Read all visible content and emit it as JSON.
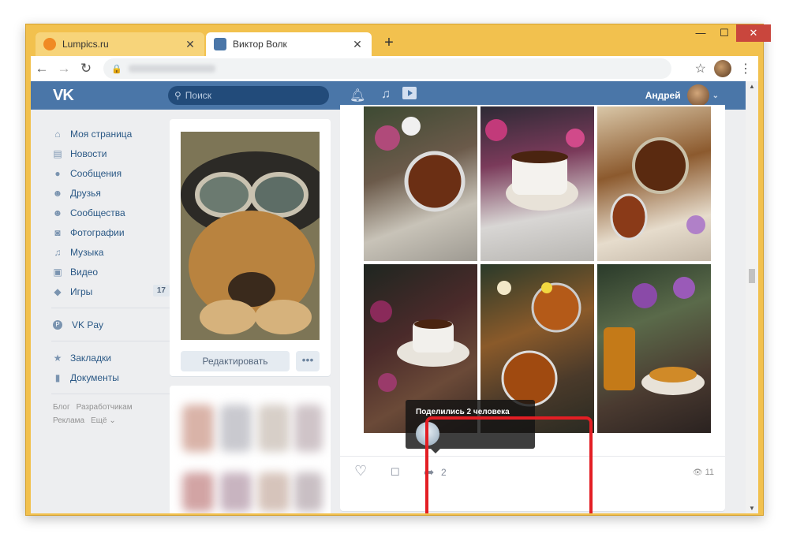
{
  "browser": {
    "tabs": [
      {
        "title": "Lumpics.ru",
        "active": false,
        "favicon_color": "#f08a24"
      },
      {
        "title": "Виктор Волк",
        "active": true,
        "favicon_color": "#4a76a8"
      }
    ],
    "new_tab": "+",
    "close_glyph": "✕",
    "window_controls": {
      "minimize": "—",
      "maximize": "☐",
      "close": "✕"
    },
    "nav": {
      "back": "←",
      "forward": "→",
      "reload": "↻"
    },
    "lock_icon": "🔒",
    "star": "☆",
    "menu": "⋮"
  },
  "vk": {
    "logo": "VK",
    "search_placeholder": "Поиск",
    "user_name": "Андрей",
    "header_icons": [
      "bell-icon",
      "music-icon",
      "video-icon"
    ],
    "nav": [
      {
        "icon": "home-icon",
        "glyph": "⌂",
        "label": "Моя страница"
      },
      {
        "icon": "news-icon",
        "glyph": "▤",
        "label": "Новости"
      },
      {
        "icon": "messages-icon",
        "glyph": "●",
        "label": "Сообщения"
      },
      {
        "icon": "friends-icon",
        "glyph": "☻",
        "label": "Друзья"
      },
      {
        "icon": "communities-icon",
        "glyph": "☻",
        "label": "Сообщества"
      },
      {
        "icon": "photos-icon",
        "glyph": "◙",
        "label": "Фотографии"
      },
      {
        "icon": "music-icon",
        "glyph": "♫",
        "label": "Музыка"
      },
      {
        "icon": "video-icon",
        "glyph": "▣",
        "label": "Видео"
      },
      {
        "icon": "games-icon",
        "glyph": "◆",
        "label": "Игры",
        "badge": "17"
      }
    ],
    "nav_pay": {
      "icon": "vkpay-icon",
      "glyph": "P",
      "label": "VK Pay"
    },
    "nav_extra": [
      {
        "icon": "bookmarks-icon",
        "glyph": "★",
        "label": "Закладки"
      },
      {
        "icon": "documents-icon",
        "glyph": "▮",
        "label": "Документы"
      }
    ],
    "footer_links": [
      "Блог",
      "Разработчикам",
      "Реклама",
      "Ещё ⌄"
    ],
    "edit_button": "Редактировать",
    "more_button": "•••",
    "post": {
      "likes_glyph": "♡",
      "comment_glyph": "☐",
      "share_glyph": "➦",
      "share_count": "2",
      "views": "11",
      "views_glyph": "👁",
      "tooltip_title": "Поделились 2 человека"
    }
  },
  "colors": {
    "vk_blue": "#4a76a8",
    "link": "#2a5885",
    "highlight": "#e31e24",
    "frame": "#f2c14e"
  }
}
